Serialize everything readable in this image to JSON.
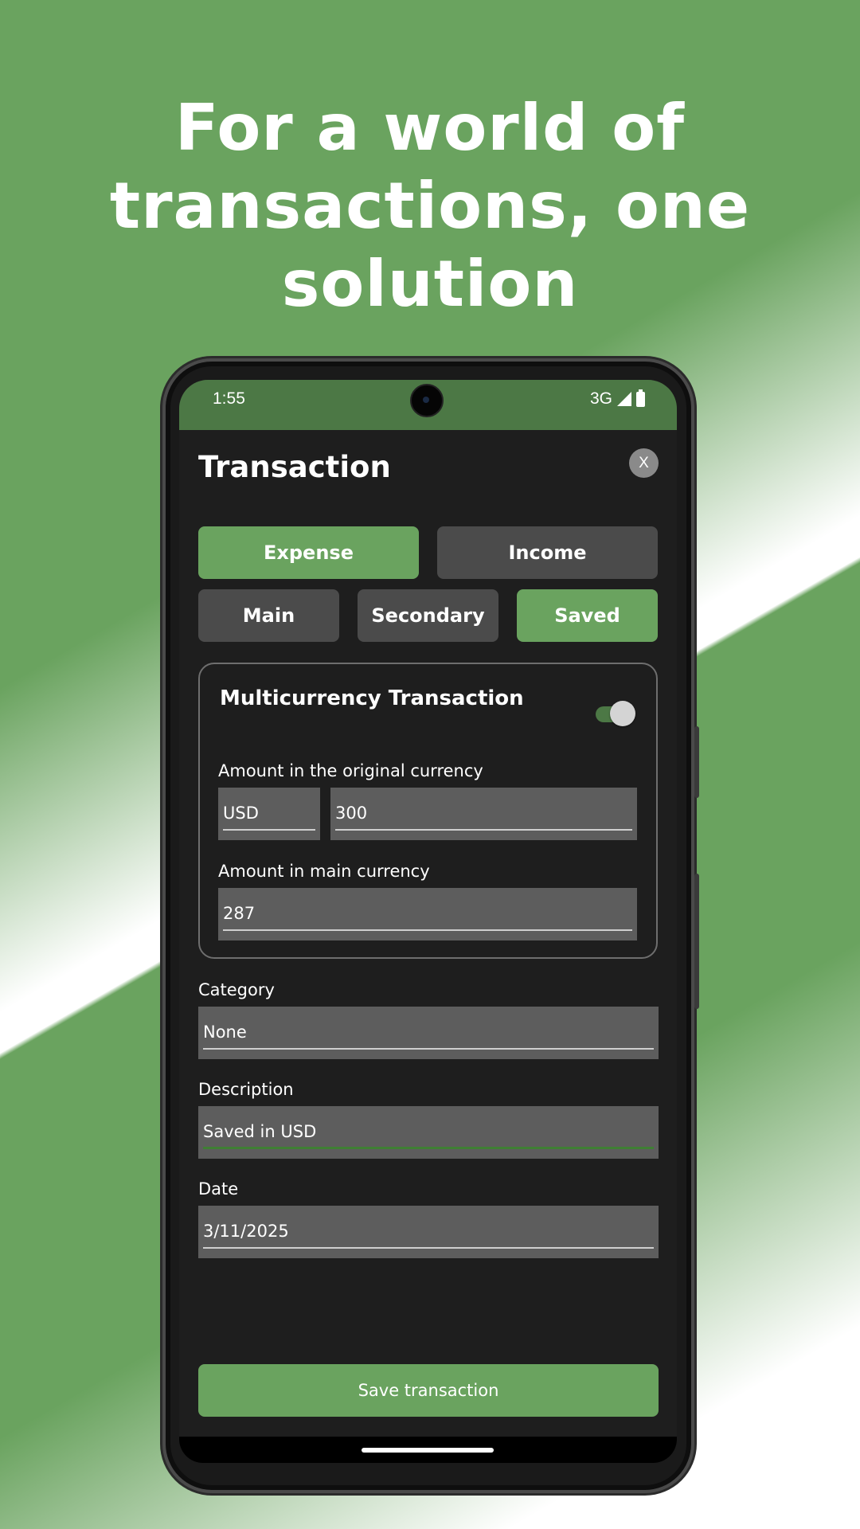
{
  "headline": "For a world of transactions, one solution",
  "status_bar": {
    "time": "1:55",
    "network": "3G"
  },
  "dialog": {
    "title": "Transaction",
    "close_label": "X"
  },
  "type_tabs": [
    {
      "label": "Expense",
      "selected": true
    },
    {
      "label": "Income",
      "selected": false
    }
  ],
  "account_tabs": [
    {
      "label": "Main",
      "selected": false
    },
    {
      "label": "Secondary",
      "selected": false
    },
    {
      "label": "Saved",
      "selected": true
    }
  ],
  "multicurrency": {
    "title": "Multicurrency Transaction",
    "enabled": true,
    "original_label": "Amount in the original currency",
    "currency_code": "USD",
    "original_amount": "300",
    "main_label": "Amount in main currency",
    "main_amount": "287"
  },
  "category": {
    "label": "Category",
    "value": "None"
  },
  "description": {
    "label": "Description",
    "value": "Saved in USD"
  },
  "date": {
    "label": "Date",
    "value": "3/11/2025"
  },
  "save_label": "Save transaction",
  "colors": {
    "accent": "#6aa35f",
    "status_bar": "#4c7845",
    "surface": "#1e1e1e",
    "field": "#5d5d5d"
  }
}
